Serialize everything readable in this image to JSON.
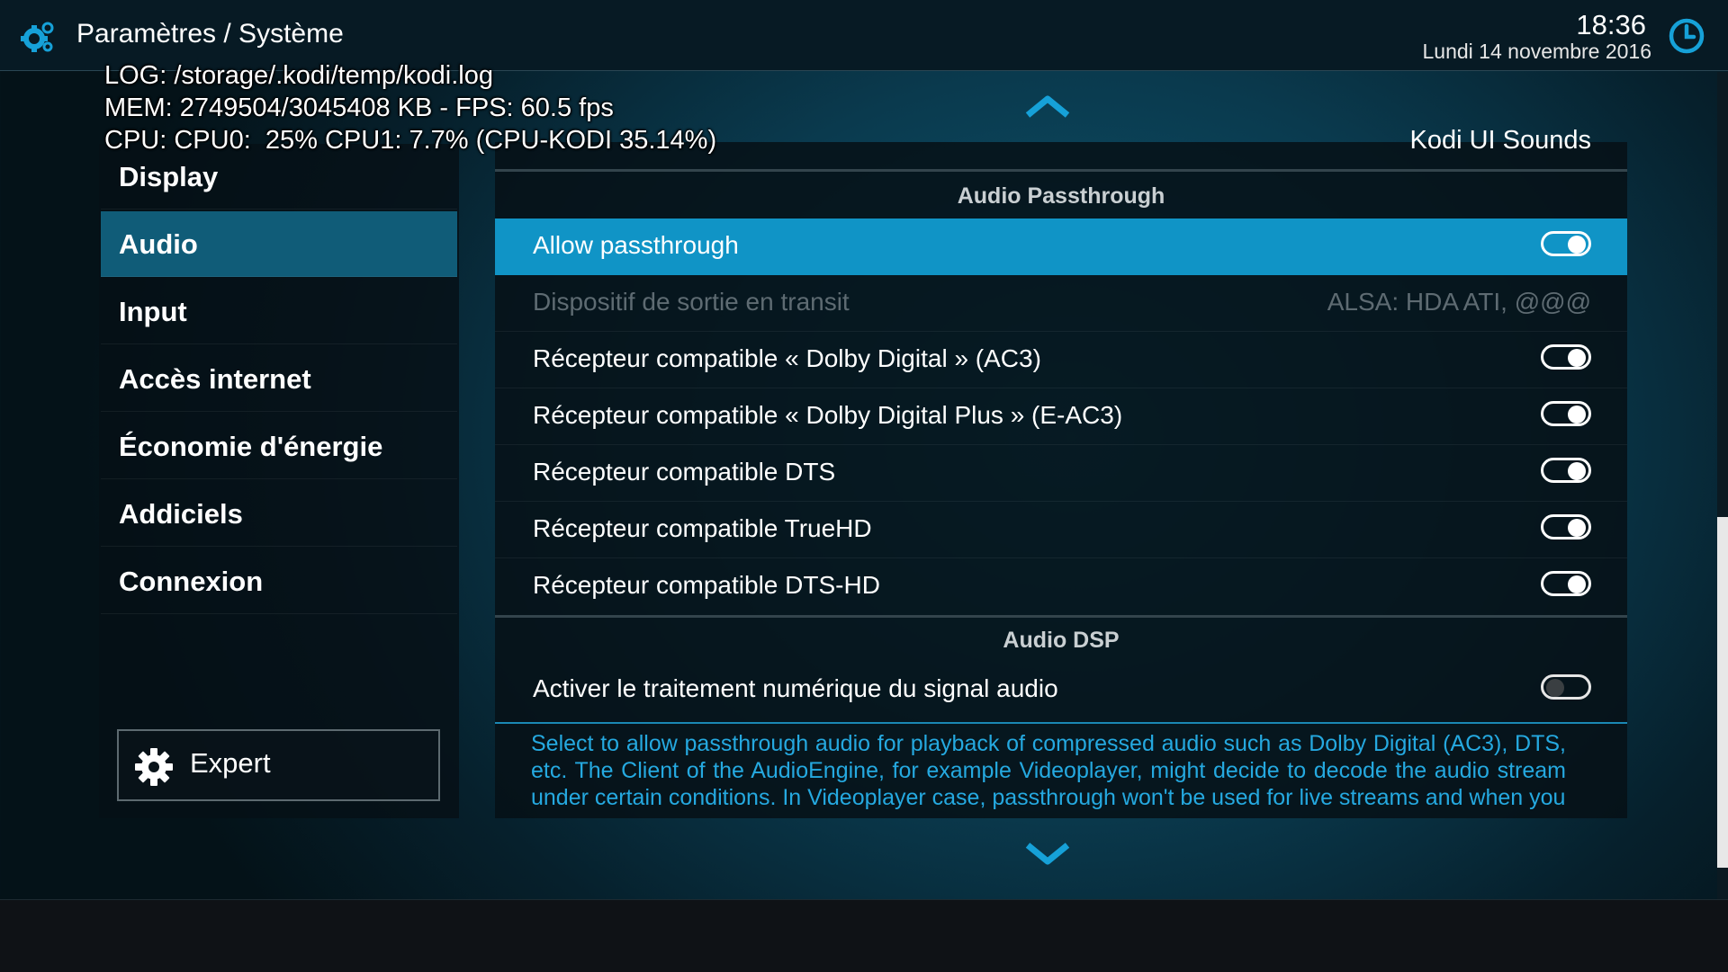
{
  "header": {
    "title": "Paramètres / Système",
    "time": "18:36",
    "date": "Lundi 14 novembre 2016"
  },
  "debug": {
    "log": "LOG: /storage/.kodi/temp/kodi.log",
    "mem": "MEM: 2749504/3045408 KB - FPS: 60.5 fps",
    "cpu": "CPU: CPU0:  25% CPU1: 7.7% (CPU-KODI 35.14%)"
  },
  "sidebar": {
    "items": [
      {
        "label": "Display"
      },
      {
        "label": "Audio"
      },
      {
        "label": "Input"
      },
      {
        "label": "Accès internet"
      },
      {
        "label": "Économie d'énergie"
      },
      {
        "label": "Addiciels"
      },
      {
        "label": "Connexion"
      }
    ],
    "active": "Audio",
    "expert_label": "Expert"
  },
  "settings": {
    "partial_top": "Kodi UI Sounds",
    "sections": [
      {
        "header": "Audio Passthrough",
        "rows": [
          {
            "label": "Allow passthrough",
            "type": "toggle",
            "value": true,
            "focused": true
          },
          {
            "label": "Dispositif de sortie en transit",
            "type": "value",
            "value": "ALSA: HDA ATI, @@@",
            "disabled": true
          },
          {
            "label": "Récepteur compatible « Dolby Digital » (AC3)",
            "type": "toggle",
            "value": true
          },
          {
            "label": "Récepteur compatible « Dolby Digital Plus » (E-AC3)",
            "type": "toggle",
            "value": true
          },
          {
            "label": "Récepteur compatible DTS",
            "type": "toggle",
            "value": true
          },
          {
            "label": "Récepteur compatible TrueHD",
            "type": "toggle",
            "value": true
          },
          {
            "label": "Récepteur compatible DTS-HD",
            "type": "toggle",
            "value": true
          }
        ]
      },
      {
        "header": "Audio DSP",
        "rows": [
          {
            "label": "Activer le traitement numérique du signal audio",
            "type": "toggle",
            "value": false
          }
        ]
      }
    ],
    "description": "Select to allow passthrough audio for playback of compressed audio such as Dolby Digital (AC3), DTS, etc. The Client of the AudioEngine, for example Videoplayer, might decide to decode the audio stream under certain conditions. In Videoplayer case, passthrough won't be used for live streams and when you"
  },
  "colors": {
    "accent": "#1094c6",
    "description_text": "#25a9e0",
    "clock_icon": "#16a1d8"
  },
  "icons": {
    "logo": "settings-cog-icon",
    "clock": "clock-icon",
    "expert": "gear-icon",
    "scroll_up": "chevron-up-icon",
    "scroll_down": "chevron-down-icon"
  }
}
